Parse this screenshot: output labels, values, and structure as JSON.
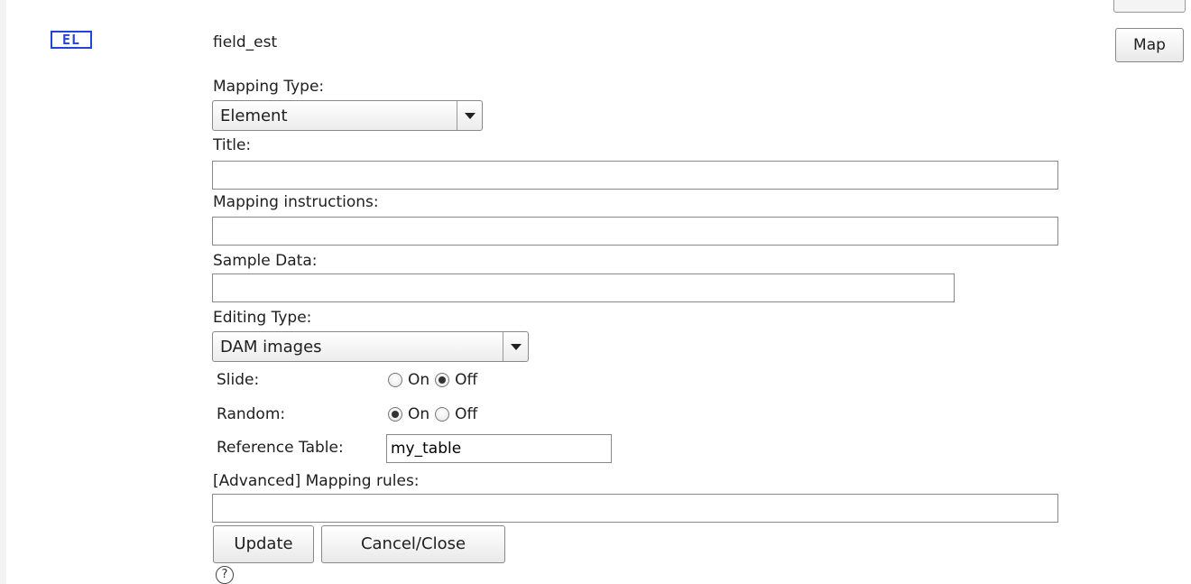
{
  "badge": {
    "text": "EL",
    "color": "#2244dd"
  },
  "field": {
    "name": "field_est"
  },
  "map_button": {
    "label": "Map"
  },
  "form": {
    "mapping_type": {
      "label": "Mapping Type:",
      "value": "Element"
    },
    "title": {
      "label": "Title:",
      "value": ""
    },
    "mapping_instructions": {
      "label": "Mapping instructions:",
      "value": ""
    },
    "sample_data": {
      "label": "Sample Data:",
      "value": ""
    },
    "editing_type": {
      "label": "Editing Type:",
      "value": "DAM images"
    },
    "slide": {
      "label": "Slide:",
      "on_label": "On",
      "off_label": "Off",
      "selected": "Off"
    },
    "random": {
      "label": "Random:",
      "on_label": "On",
      "off_label": "Off",
      "selected": "On"
    },
    "reference_table": {
      "label": "Reference Table:",
      "value": "my_table"
    },
    "mapping_rules": {
      "label": "[Advanced] Mapping rules:",
      "value": ""
    },
    "update_button": "Update",
    "cancel_button": "Cancel/Close",
    "help_icon": "?"
  }
}
